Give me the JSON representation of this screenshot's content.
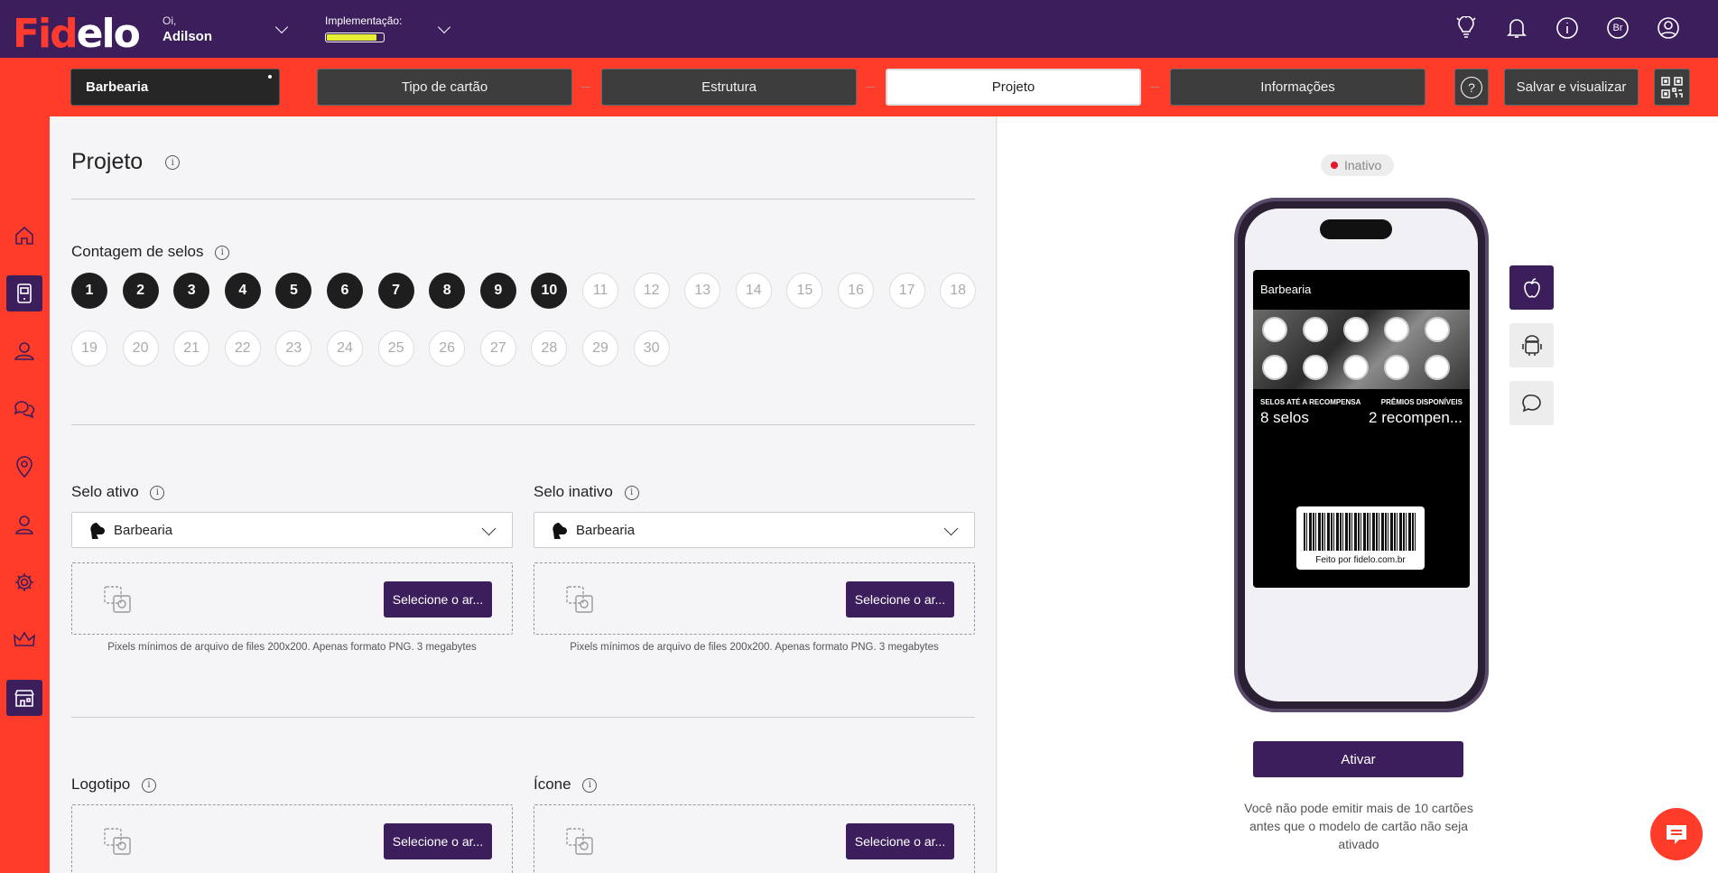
{
  "app": {
    "logo_accent": "Fid",
    "logo_rest": "elo"
  },
  "header": {
    "greeting": "Oi,",
    "user_name": "Adilson",
    "implementation_label": "Implementação:",
    "implementation_progress": 0.88,
    "icons": [
      "lightbulb-icon",
      "bell-icon",
      "info-icon",
      "language-icon",
      "user-icon"
    ],
    "language_code": "Br"
  },
  "nav": {
    "store": "Barbearia",
    "steps": [
      "Tipo de cartão",
      "Estrutura",
      "Projeto",
      "Informações"
    ],
    "active_step": "Projeto",
    "help": "?",
    "save": "Salvar e visualizar"
  },
  "sidebar": {
    "items": [
      "home-icon",
      "card-icon",
      "users-icon",
      "chat-icon",
      "location-icon",
      "person-icon",
      "gear-icon",
      "crown-icon",
      "store-icon"
    ],
    "active": [
      "card-icon",
      "store-icon"
    ]
  },
  "main": {
    "title": "Projeto",
    "stamp_count_label": "Contagem de selos",
    "stamps_row1": [
      "1",
      "2",
      "3",
      "4",
      "5",
      "6",
      "7",
      "8",
      "9",
      "10",
      "11",
      "12",
      "13",
      "14",
      "15",
      "16",
      "17",
      "18"
    ],
    "stamps_row2": [
      "19",
      "20",
      "21",
      "22",
      "23",
      "24",
      "25",
      "26",
      "27",
      "28",
      "29",
      "30"
    ],
    "selected_count": 10,
    "active_stamp_label": "Selo ativo",
    "inactive_stamp_label": "Selo inativo",
    "active_stamp_value": "Barbearia",
    "inactive_stamp_value": "Barbearia",
    "upload_button": "Selecione o ar...",
    "upload_hint": "Pixels mínimos de arquivo de files 200x200. Apenas formato PNG. 3 megabytes",
    "logo_label": "Logotipo",
    "icon_label": "Ícone"
  },
  "preview": {
    "status": "Inativo",
    "card_title": "Barbearia",
    "left_label": "SELOS ATÉ A RECOMPENSA",
    "left_value": "8 selos",
    "right_label": "PRÊMIOS DISPONÍVEIS",
    "right_value": "2 recompen...",
    "barcode_text": "Feito por fidelo.com.br",
    "platforms": [
      "apple-icon",
      "android-icon",
      "message-icon"
    ],
    "activate": "Ativar",
    "warning": "Você não pode emitir mais de 10 cartões antes que o modelo de cartão não seja ativado"
  },
  "colors": {
    "purple": "#3b1e5b",
    "red": "#ff3b2a",
    "dark": "#1e1e1e",
    "inactive_dot": "#e4162e"
  }
}
